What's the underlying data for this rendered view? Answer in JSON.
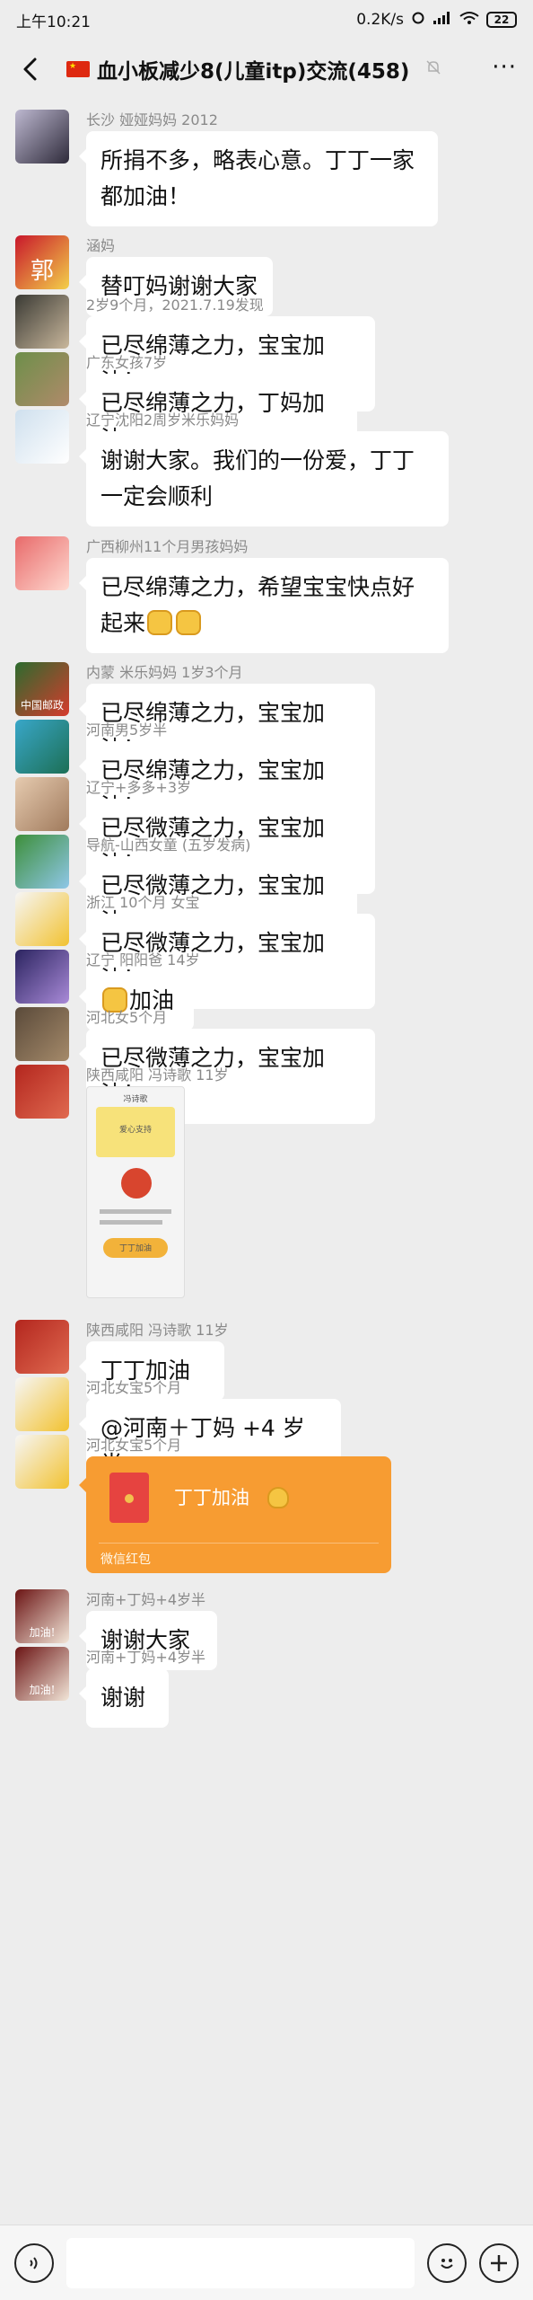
{
  "status_bar": {
    "time": "上午10:21",
    "speed": "0.2K/s",
    "battery": "22"
  },
  "header": {
    "title": "血小板减少8(儿童itp)交流(458)",
    "more_label": "···",
    "mute_icon": "mute-bell-icon"
  },
  "messages": [
    {
      "sender": "长沙 娅娅妈妈 2012",
      "text": "所捐不多，略表心意。丁丁一家都加油！",
      "avatar_colors": [
        "#bdb8d0",
        "#2e2a3a"
      ]
    },
    {
      "sender": "涵妈",
      "text": "替叮妈谢谢大家",
      "avatar_colors": [
        "#c8172b",
        "#f3d04a"
      ],
      "avatar_text": "郭"
    },
    {
      "sender": "2岁9个月，2021.7.19发现",
      "text": "已尽绵薄之力，宝宝加油！",
      "avatar_colors": [
        "#3a3a34",
        "#c9b79c"
      ]
    },
    {
      "sender": "广东女孩7岁",
      "text": "已尽绵薄之力，丁妈加油",
      "avatar_colors": [
        "#6d8f4a",
        "#b08a6a"
      ]
    },
    {
      "sender": "辽宁沈阳2周岁米乐妈妈",
      "text": "谢谢大家。我们的一份爱，丁丁一定会顺利",
      "avatar_colors": [
        "#cfe0ee",
        "#ffffff"
      ]
    },
    {
      "sender": "广西柳州11个月男孩妈妈",
      "text": "已尽绵薄之力，希望宝宝快点好起来",
      "text_suffix_emoji": 2,
      "avatar_colors": [
        "#e86a6a",
        "#ffd9d0"
      ]
    },
    {
      "sender": "内蒙 米乐妈妈 1岁3个月",
      "text": "已尽绵薄之力，宝宝加油！",
      "avatar_colors": [
        "#2c6b2e",
        "#d63b2d"
      ],
      "avatar_text": "中国邮政"
    },
    {
      "sender": "河南男5岁半",
      "text": "已尽绵薄之力，宝宝加油！",
      "avatar_colors": [
        "#39a7c9",
        "#1c6f55"
      ]
    },
    {
      "sender": "辽宁+多多+3岁",
      "text": "已尽微薄之力，宝宝加油！",
      "avatar_colors": [
        "#e6cbb0",
        "#a07a5c"
      ]
    },
    {
      "sender": "导航-山西女童 (五岁发病)",
      "text": "已尽微薄之力，宝宝加油",
      "avatar_colors": [
        "#3d8f3a",
        "#8fc7e8"
      ]
    },
    {
      "sender": "浙江 10个月 女宝",
      "text": "已尽微薄之力，宝宝加油！",
      "avatar_colors": [
        "#f6f6f6",
        "#f2c230"
      ]
    },
    {
      "sender": "辽宁 阳阳爸 14岁",
      "text": "加油",
      "text_prefix_emoji": 1,
      "avatar_colors": [
        "#2b2460",
        "#a98ad8"
      ]
    },
    {
      "sender": "河北女5个月",
      "text": "已尽微薄之力，宝宝加油！",
      "avatar_colors": [
        "#5a4a3a",
        "#a58a6a"
      ]
    },
    {
      "sender": "陕西咸阳 冯诗歌 11岁",
      "image": true,
      "avatar_colors": [
        "#b3261e",
        "#e06a50"
      ],
      "image_lines": [
        "冯诗歌",
        "爱心支持",
        "丁丁加油"
      ]
    },
    {
      "sender": "陕西咸阳 冯诗歌 11岁",
      "text": "丁丁加油",
      "avatar_colors": [
        "#b3261e",
        "#e06a50"
      ]
    },
    {
      "sender": "河北女宝5个月",
      "text": "@河南＋丁妈 +4 岁半",
      "avatar_colors": [
        "#f6f6f6",
        "#f2c230"
      ]
    },
    {
      "sender": "河北女宝5个月",
      "red_packet": {
        "text": "丁丁加油",
        "label": "微信红包"
      },
      "avatar_colors": [
        "#f6f6f6",
        "#f2c230"
      ]
    },
    {
      "sender": "河南+丁妈+4岁半",
      "text": "谢谢大家",
      "avatar_colors": [
        "#6b1414",
        "#f2e6d8"
      ],
      "avatar_text": "加油!"
    },
    {
      "sender": "河南+丁妈+4岁半",
      "text": "谢谢",
      "avatar_colors": [
        "#6b1414",
        "#f2e6d8"
      ],
      "avatar_text": "加油!"
    }
  ],
  "input_bar": {
    "voice_icon": "voice-icon",
    "emoji_icon": "emoji-icon",
    "plus_icon": "plus-icon",
    "placeholder": ""
  },
  "colors": {
    "background": "#ededed",
    "bubble": "#ffffff",
    "red_packet": "#f79c32",
    "sender_text": "#8a8a8a"
  }
}
